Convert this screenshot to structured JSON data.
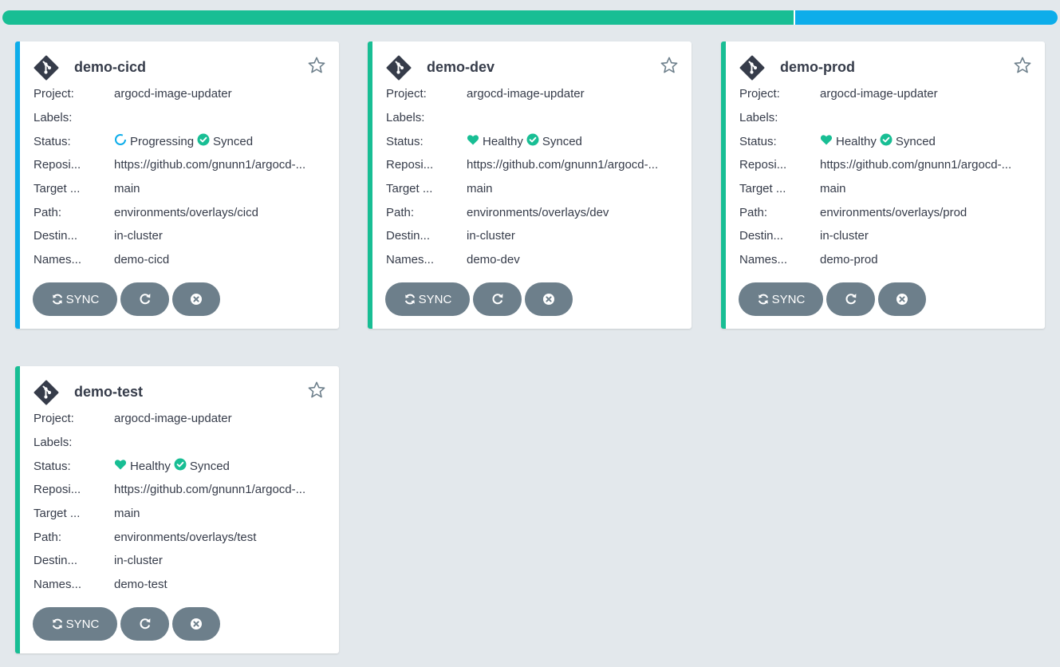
{
  "colors": {
    "healthy": "#18be94",
    "synced": "#18be94",
    "progressing": "#0dadea",
    "card_border_progressing": "#0dadea",
    "card_border_healthy": "#18be94",
    "button_bg": "#6d7f8b"
  },
  "summary_bar": [
    {
      "status": "Healthy",
      "fraction": 0.75,
      "color": "#18be94"
    },
    {
      "status": "Progressing",
      "fraction": 0.25,
      "color": "#0dadea"
    }
  ],
  "field_labels": {
    "project": "Project:",
    "labels": "Labels:",
    "status": "Status:",
    "repository": "Reposi...",
    "target": "Target ...",
    "path": "Path:",
    "destination": "Destin...",
    "namespace": "Names..."
  },
  "buttons": {
    "sync_label": "SYNC",
    "sync_icon": "sync-icon",
    "refresh_icon": "refresh-icon",
    "delete_icon": "times-circle-icon"
  },
  "apps": [
    {
      "name": "demo-cicd",
      "project": "argocd-image-updater",
      "labels": "",
      "health": "Progressing",
      "health_icon": "progressing-circle-icon",
      "sync": "Synced",
      "repository": "https://github.com/gnunn1/argocd-...",
      "target": "main",
      "path": "environments/overlays/cicd",
      "destination": "in-cluster",
      "namespace": "demo-cicd"
    },
    {
      "name": "demo-dev",
      "project": "argocd-image-updater",
      "labels": "",
      "health": "Healthy",
      "health_icon": "heart-icon",
      "sync": "Synced",
      "repository": "https://github.com/gnunn1/argocd-...",
      "target": "main",
      "path": "environments/overlays/dev",
      "destination": "in-cluster",
      "namespace": "demo-dev"
    },
    {
      "name": "demo-prod",
      "project": "argocd-image-updater",
      "labels": "",
      "health": "Healthy",
      "health_icon": "heart-icon",
      "sync": "Synced",
      "repository": "https://github.com/gnunn1/argocd-...",
      "target": "main",
      "path": "environments/overlays/prod",
      "destination": "in-cluster",
      "namespace": "demo-prod"
    },
    {
      "name": "demo-test",
      "project": "argocd-image-updater",
      "labels": "",
      "health": "Healthy",
      "health_icon": "heart-icon",
      "sync": "Synced",
      "repository": "https://github.com/gnunn1/argocd-...",
      "target": "main",
      "path": "environments/overlays/test",
      "destination": "in-cluster",
      "namespace": "demo-test"
    }
  ]
}
